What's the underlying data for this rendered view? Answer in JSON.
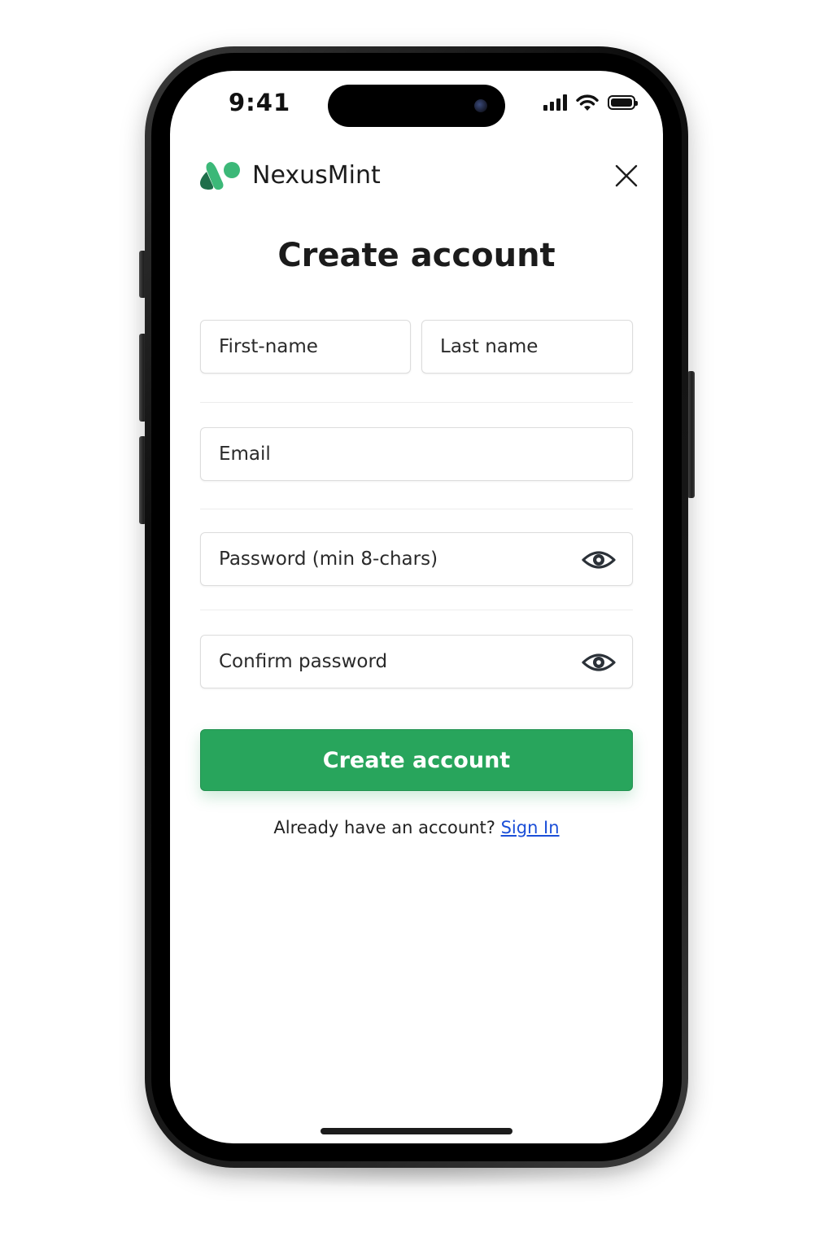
{
  "status_bar": {
    "time": "9:41"
  },
  "header": {
    "brand_name": "NexusMint",
    "logo_icon": "nexusmint-logo-icon",
    "close_icon": "close-icon"
  },
  "page": {
    "title": "Create account"
  },
  "form": {
    "first_name_placeholder": "First-name",
    "last_name_placeholder": "Last name",
    "email_placeholder": "Email",
    "password_placeholder": "Password (min 8-chars)",
    "confirm_password_placeholder": "Confirm password",
    "show_password_icon": "eye-icon",
    "submit_label": "Create account"
  },
  "footer": {
    "prompt": "Already have an account?",
    "signin_label": "Sign In"
  },
  "colors": {
    "primary_button": "#28a55c",
    "link": "#1b4fd8",
    "logo_dark": "#1f6e4a",
    "logo_light": "#3cb878"
  }
}
